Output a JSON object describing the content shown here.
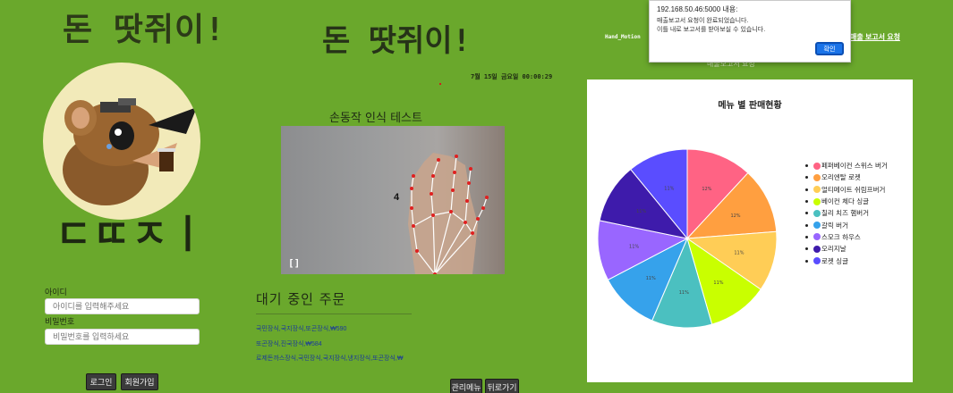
{
  "left": {
    "logo_title": "돈 땃쥐이!",
    "mascot_text": "ㄷㄸㅈㅣ",
    "id_label": "아이디",
    "id_placeholder": "아이디를 입력해주세요",
    "pw_label": "비밀번호",
    "pw_placeholder": "비밀번호를 입력하세요",
    "login_label": "로그인",
    "signup_label": "회원가입"
  },
  "middle": {
    "title": "돈 땃쥐이!",
    "datetime": "7월 15일 금요일 00:00:29",
    "camera_heading": "손동작 인식 테스트",
    "camera_count": "4",
    "camera_bracket": "[]",
    "waiting_title": "대기 중인 주문",
    "orders": [
      "국민장식,국지장식,또곤장식,₩590",
      "또곤장식,진국장식,₩584",
      "로제돈까스장식,국민장식,국지장식,냉지장식,또곤장식,₩"
    ],
    "admin_label": "관리메뉴",
    "back_label": "뒤로가기"
  },
  "right": {
    "brand": "Hand_Motion",
    "report_link": "매출 보고서 요청",
    "faded_sub": "매출보고서 요청",
    "chart_data": {
      "type": "pie",
      "title": "메뉴 별 판매현황",
      "categories": [
        "페퍼베이컨 스위스 버거",
        "오리엔탈 로켓",
        "얼티메이트 쉬림프버거",
        "베이컨 체다 싱글",
        "칠리 치즈 햄버거",
        "갈릭 버거",
        "스모크 하우스",
        "오리지날",
        "로켓 싱글"
      ],
      "values": [
        12,
        12,
        11,
        11,
        11,
        11,
        11,
        11,
        11
      ],
      "colors": [
        "#ff6384",
        "#ff9f40",
        "#ffcd56",
        "#c9ff00",
        "#4bc0c0",
        "#36a2eb",
        "#9966ff",
        "#3e1bab",
        "#5a4dff"
      ],
      "legend_position": "right"
    }
  },
  "alert": {
    "origin": "192.168.50.46:5000 내용:",
    "line1": "매출보고서 요청이 완료되었습니다.",
    "line2": "이틀 내로 보고서를 받아보실 수 있습니다.",
    "ok_label": "확인"
  }
}
